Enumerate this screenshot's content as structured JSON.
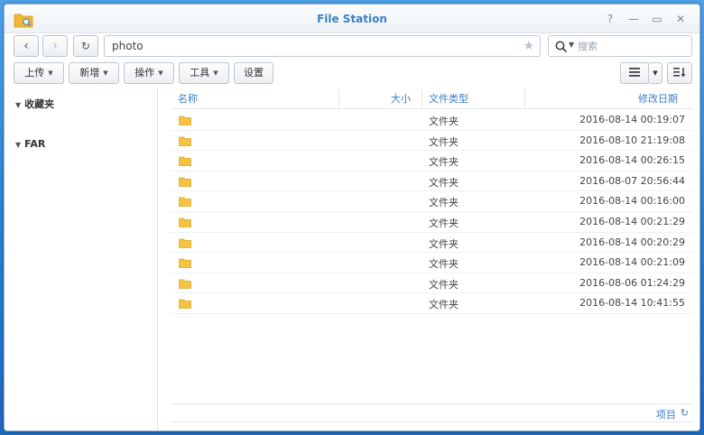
{
  "window": {
    "title": "File Station",
    "controls": [
      "?",
      "—",
      "▭",
      "✕"
    ]
  },
  "nav": {
    "path": "photo",
    "search_placeholder": "搜索"
  },
  "toolbar": {
    "upload": "上传",
    "new": "新增",
    "action": "操作",
    "tools": "工具",
    "settings": "设置"
  },
  "sidebar": {
    "favorites": "收藏夹",
    "far": "FAR"
  },
  "columns": {
    "name": "名称",
    "size": "大小",
    "type": "文件类型",
    "modified": "修改日期"
  },
  "rows": [
    {
      "type": "文件夹",
      "modified": "2016-08-14 00:19:07"
    },
    {
      "type": "文件夹",
      "modified": "2016-08-10 21:19:08"
    },
    {
      "type": "文件夹",
      "modified": "2016-08-14 00:26:15"
    },
    {
      "type": "文件夹",
      "modified": "2016-08-07 20:56:44"
    },
    {
      "type": "文件夹",
      "modified": "2016-08-14 00:16:00"
    },
    {
      "type": "文件夹",
      "modified": "2016-08-14 00:21:29"
    },
    {
      "type": "文件夹",
      "modified": "2016-08-14 00:20:29"
    },
    {
      "type": "文件夹",
      "modified": "2016-08-14 00:21:09"
    },
    {
      "type": "文件夹",
      "modified": "2016-08-06 01:24:29"
    },
    {
      "type": "文件夹",
      "modified": "2016-08-14 10:41:55"
    }
  ],
  "footer": {
    "items_label": "项目"
  },
  "colors": {
    "accent": "#3b82c6",
    "folder": "#f5c242"
  }
}
